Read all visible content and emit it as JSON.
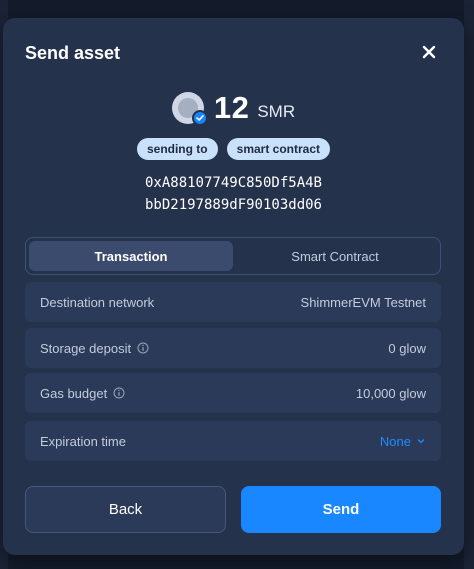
{
  "modal": {
    "title": "Send asset",
    "close_icon": "close-icon"
  },
  "amount": {
    "value": "12",
    "unit": "SMR",
    "token_icon": "shimmer-token-icon",
    "verified_icon": "verified-check-icon"
  },
  "pills": {
    "sending_to": "sending to",
    "recipient_type": "smart contract"
  },
  "address": {
    "line1": "0xA88107749C850Df5A4B",
    "line2": "bbD2197889dF90103dd06"
  },
  "tabs": [
    {
      "label": "Transaction",
      "active": true
    },
    {
      "label": "Smart Contract",
      "active": false
    }
  ],
  "details": {
    "destination_network": {
      "label": "Destination network",
      "value": "ShimmerEVM Testnet"
    },
    "storage_deposit": {
      "label": "Storage deposit",
      "value": "0 glow"
    },
    "gas_budget": {
      "label": "Gas budget",
      "value": "10,000 glow"
    },
    "expiration_time": {
      "label": "Expiration time",
      "value": "None"
    }
  },
  "buttons": {
    "back": "Back",
    "send": "Send"
  },
  "colors": {
    "accent": "#1987ff",
    "modal_bg": "#25324c",
    "pill_bg": "#c9e1fb"
  }
}
